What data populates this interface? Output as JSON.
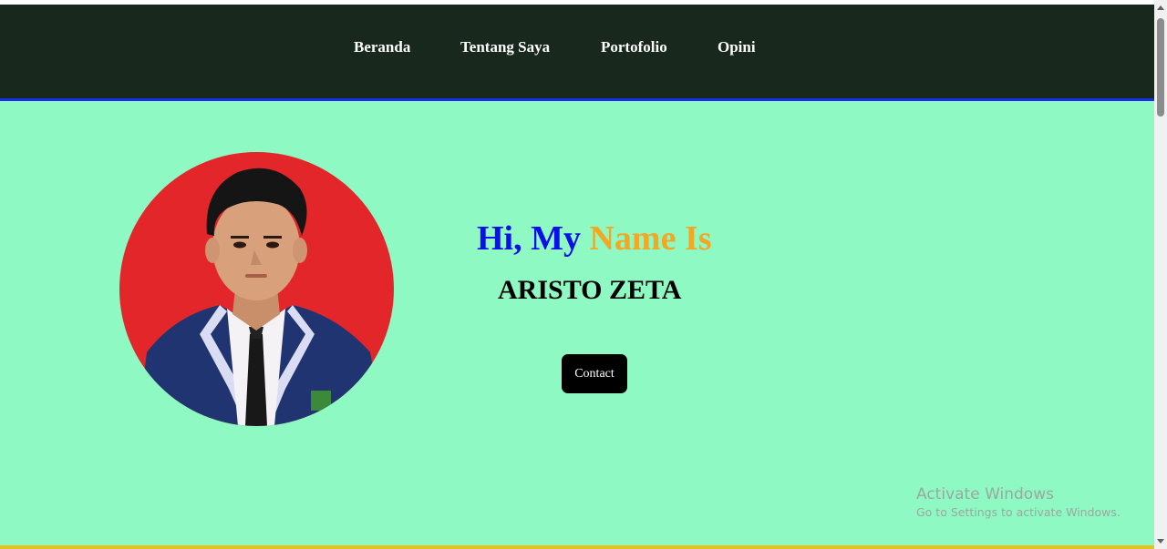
{
  "nav": {
    "items": [
      {
        "label": "Beranda"
      },
      {
        "label": "Tentang Saya"
      },
      {
        "label": "Portofolio"
      },
      {
        "label": "Opini"
      }
    ]
  },
  "hero": {
    "greeting_part1": "Hi, My",
    "greeting_part2": "Name Is",
    "name": "ARISTO ZETA",
    "contact_label": "Contact",
    "avatar_icon": "profile-photo"
  },
  "watermark": {
    "title": "Activate Windows",
    "subtitle": "Go to Settings to activate Windows."
  },
  "colors": {
    "nav_bg": "#18281d",
    "nav_border": "#1a2cf0",
    "hero_bg": "#8ef9c3",
    "greeting_blue": "#0b10e8",
    "greeting_orange": "#f5a623",
    "bottom_line": "#e5c21c"
  }
}
